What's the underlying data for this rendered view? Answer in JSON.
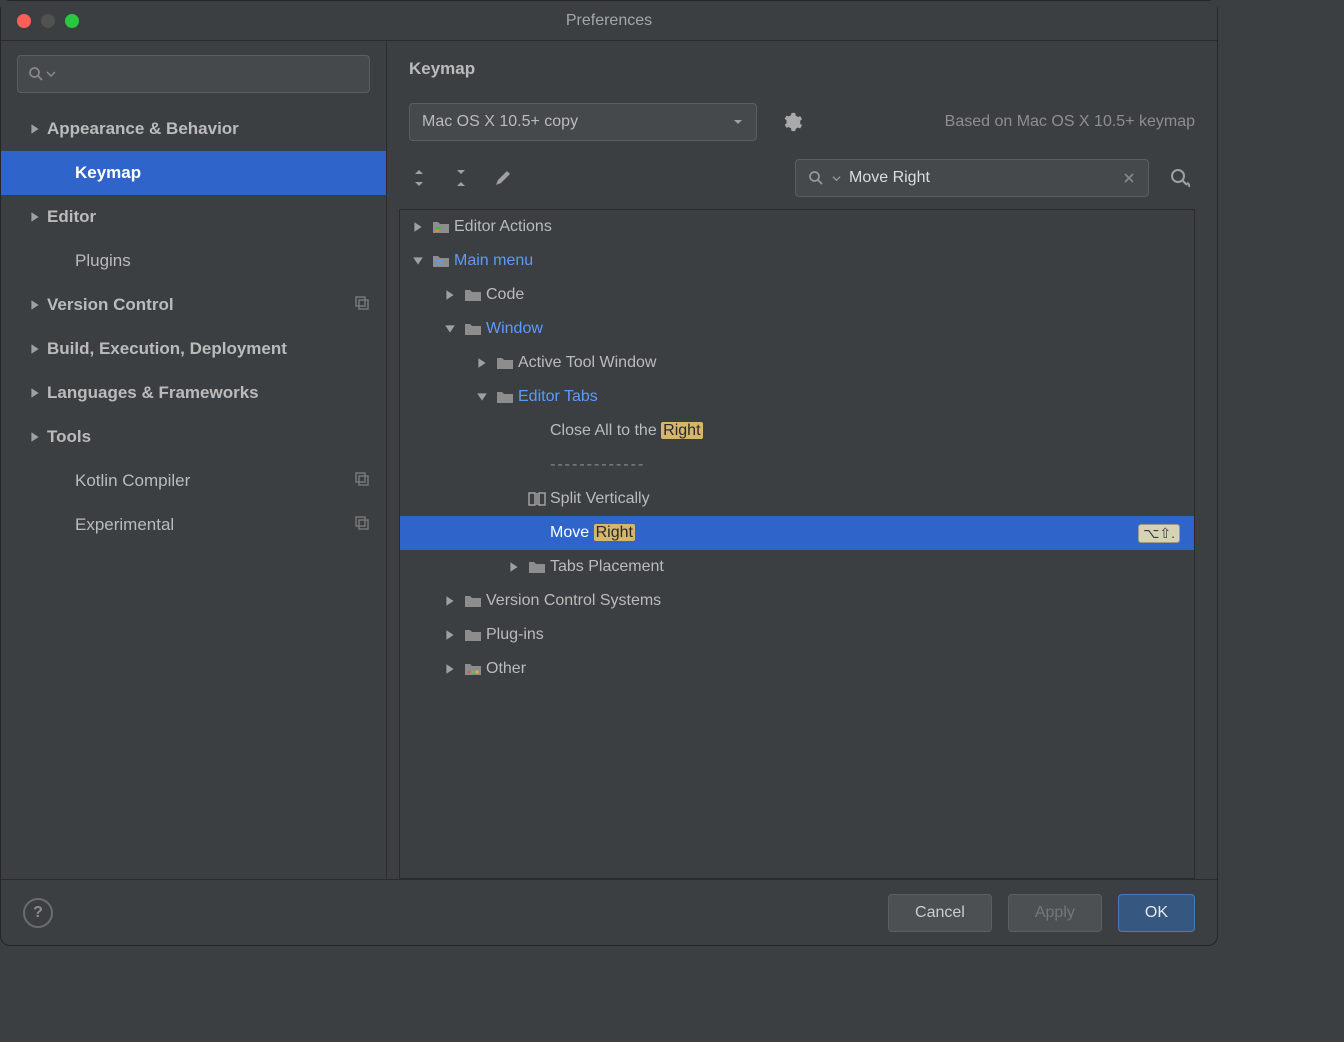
{
  "window": {
    "title": "Preferences"
  },
  "sidebar": {
    "items": [
      {
        "label": "Appearance & Behavior",
        "bold": true,
        "arrow": true
      },
      {
        "label": "Keymap",
        "bold": true,
        "selected": true,
        "indent": true
      },
      {
        "label": "Editor",
        "bold": true,
        "arrow": true
      },
      {
        "label": "Plugins",
        "indent": true
      },
      {
        "label": "Version Control",
        "bold": true,
        "arrow": true,
        "ext": true
      },
      {
        "label": "Build, Execution, Deployment",
        "bold": true,
        "arrow": true
      },
      {
        "label": "Languages & Frameworks",
        "bold": true,
        "arrow": true
      },
      {
        "label": "Tools",
        "bold": true,
        "arrow": true
      },
      {
        "label": "Kotlin Compiler",
        "indent": true,
        "ext": true
      },
      {
        "label": "Experimental",
        "indent": true,
        "ext": true
      }
    ]
  },
  "main": {
    "title": "Keymap",
    "keymap_name": "Mac OS X 10.5+ copy",
    "based_on": "Based on Mac OS X 10.5+ keymap",
    "search_value": "Move Right",
    "shortcut": "⌥⇧."
  },
  "tree": {
    "rows": [
      {
        "depth": 0,
        "exp": "closed",
        "icon": "editor",
        "label": "Editor Actions"
      },
      {
        "depth": 0,
        "exp": "open",
        "icon": "menu",
        "label": "Main menu",
        "link": true
      },
      {
        "depth": 1,
        "exp": "closed",
        "icon": "folder",
        "label": "Code"
      },
      {
        "depth": 1,
        "exp": "open",
        "icon": "folder",
        "label": "Window",
        "link": true
      },
      {
        "depth": 2,
        "exp": "closed",
        "icon": "folder",
        "label": "Active Tool Window"
      },
      {
        "depth": 2,
        "exp": "open",
        "icon": "folder",
        "label": "Editor Tabs",
        "link": true
      },
      {
        "depth": 3,
        "label_pre": "Close All to the ",
        "hl": "Right"
      },
      {
        "depth": 3,
        "sep": true
      },
      {
        "depth": 3,
        "icon": "split",
        "label": "Split Vertically"
      },
      {
        "depth": 3,
        "label_pre": "Move ",
        "hl": "Right",
        "selected": true,
        "shortcut": true
      },
      {
        "depth": 3,
        "exp": "closed",
        "icon": "folder",
        "label": "Tabs Placement"
      },
      {
        "depth": 1,
        "exp": "closed",
        "icon": "folder",
        "label": "Version Control Systems"
      },
      {
        "depth": 1,
        "exp": "closed",
        "icon": "folder",
        "label": "Plug-ins"
      },
      {
        "depth": 1,
        "exp": "closed",
        "icon": "other",
        "label": "Other"
      }
    ]
  },
  "buttons": {
    "cancel": "Cancel",
    "apply": "Apply",
    "ok": "OK"
  }
}
